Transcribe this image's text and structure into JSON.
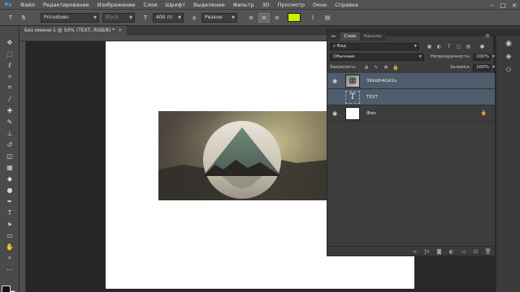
{
  "app": {
    "logo": "Ps"
  },
  "menu": [
    "Файл",
    "Редактирование",
    "Изображение",
    "Слои",
    "Шрифт",
    "Выделение",
    "Фильтр",
    "3D",
    "Просмотр",
    "Окно",
    "Справка"
  ],
  "options": {
    "font_family": "Pricedown",
    "font_style": "Black",
    "font_size": "400 пт",
    "antialias": "Резкое",
    "text_color": "#c8f000"
  },
  "document": {
    "tab_title": "Без имени-1 @ 50% (TEXT, RGB/8) *"
  },
  "layers_panel": {
    "tabs": [
      "Слои",
      "Каналы"
    ],
    "filter_kind": "Вид",
    "blend_mode": "Обычные",
    "opacity_label": "Непрозрачность:",
    "opacity_value": "100%",
    "lock_label": "Закрепить:",
    "fill_label": "Заливка:",
    "fill_value": "100%",
    "layers": [
      {
        "name": "3Rkb8i4Qd1x",
        "type": "smart",
        "visible": true,
        "selected": true
      },
      {
        "name": "TEXT",
        "type": "text",
        "visible": false,
        "selected": true
      },
      {
        "name": "Фон",
        "type": "background",
        "visible": true,
        "selected": false,
        "locked": true
      }
    ]
  },
  "colors": {
    "accent": "#31a8ff",
    "selection": "#4e5c6c",
    "text_swatch": "#c8f000"
  }
}
